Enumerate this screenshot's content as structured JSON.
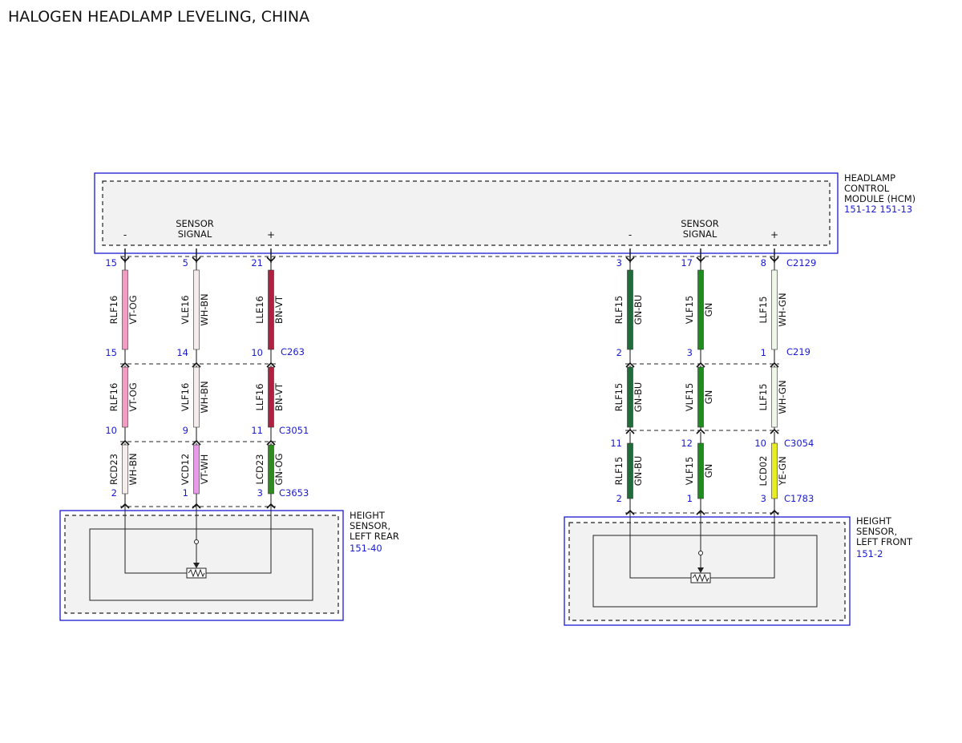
{
  "title": "HALOGEN HEADLAMP LEVELING, CHINA",
  "hcm": {
    "name_lines": [
      "HEADLAMP",
      "CONTROL",
      "MODULE (HCM)"
    ],
    "refs": "151-12  151-13",
    "left_group_label": [
      "SENSOR",
      "SIGNAL"
    ],
    "right_group_label": [
      "SENSOR",
      "SIGNAL"
    ],
    "polarity": [
      "-",
      "+",
      "-",
      "+"
    ]
  },
  "connectors": {
    "c2129": "C2129",
    "c263": "C263",
    "c219": "C219",
    "c3051": "C3051",
    "c3054": "C3054",
    "c3653": "C3653",
    "c1783": "C1783"
  },
  "sensors": {
    "left_rear": {
      "lines": [
        "HEIGHT",
        "SENSOR,",
        "LEFT REAR"
      ],
      "ref": "151-40"
    },
    "left_front": {
      "lines": [
        "HEIGHT",
        "SENSOR,",
        "LEFT FRONT"
      ],
      "ref": "151-2"
    }
  },
  "wires": [
    {
      "id": "w1",
      "segments": [
        {
          "pin_top": "15",
          "circuit": "RLF16",
          "color": "VT-OG",
          "hex": "#f29cc4",
          "pin_bot": "15"
        },
        {
          "circuit": "RLF16",
          "color": "VT-OG",
          "hex": "#f29cc4",
          "pin_bot": "10"
        },
        {
          "circuit": "RCD23",
          "color": "WH-BN",
          "hex": "#f5ecec",
          "pin_bot": "2"
        }
      ]
    },
    {
      "id": "w2",
      "segments": [
        {
          "pin_top": "5",
          "circuit": "VLE16",
          "color": "WH-BN",
          "hex": "#f5ecec",
          "pin_bot": "14"
        },
        {
          "circuit": "VLF16",
          "color": "WH-BN",
          "hex": "#f5ecec",
          "pin_bot": "9"
        },
        {
          "circuit": "VCD12",
          "color": "VT-WH",
          "hex": "#e899e8",
          "pin_bot": "1"
        }
      ]
    },
    {
      "id": "w3",
      "segments": [
        {
          "pin_top": "21",
          "circuit": "LLE16",
          "color": "BN-VT",
          "hex": "#b0213f",
          "pin_bot": "10"
        },
        {
          "circuit": "LLF16",
          "color": "BN-VT",
          "hex": "#b0213f",
          "pin_bot": "11"
        },
        {
          "circuit": "LCD23",
          "color": "GN-OG",
          "hex": "#2e8b1e",
          "pin_bot": "3"
        }
      ]
    },
    {
      "id": "w4",
      "segments": [
        {
          "pin_top": "3",
          "circuit": "RLF15",
          "color": "GN-BU",
          "hex": "#1f6e3a",
          "pin_bot": "2"
        },
        {
          "circuit": "RLF15",
          "color": "GN-BU",
          "hex": "#1f6e3a",
          "pin_bot": "11"
        },
        {
          "circuit": "RLF15",
          "color": "GN-BU",
          "hex": "#1f6e3a",
          "pin_bot": "2"
        }
      ]
    },
    {
      "id": "w5",
      "segments": [
        {
          "pin_top": "17",
          "circuit": "VLF15",
          "color": "GN",
          "hex": "#1e8c1e",
          "pin_bot": "3"
        },
        {
          "circuit": "VLF15",
          "color": "GN",
          "hex": "#1e8c1e",
          "pin_bot": "12"
        },
        {
          "circuit": "VLF15",
          "color": "GN",
          "hex": "#1e8c1e",
          "pin_bot": "1"
        }
      ]
    },
    {
      "id": "w6",
      "segments": [
        {
          "pin_top": "8",
          "circuit": "LLF15",
          "color": "WH-GN",
          "hex": "#eef7e8",
          "pin_bot": "1"
        },
        {
          "circuit": "LLF15",
          "color": "WH-GN",
          "hex": "#eef7e8",
          "pin_bot": "10"
        },
        {
          "circuit": "LCD02",
          "color": "YE-GN",
          "hex": "#e8ec22",
          "pin_bot": "3"
        }
      ]
    }
  ]
}
